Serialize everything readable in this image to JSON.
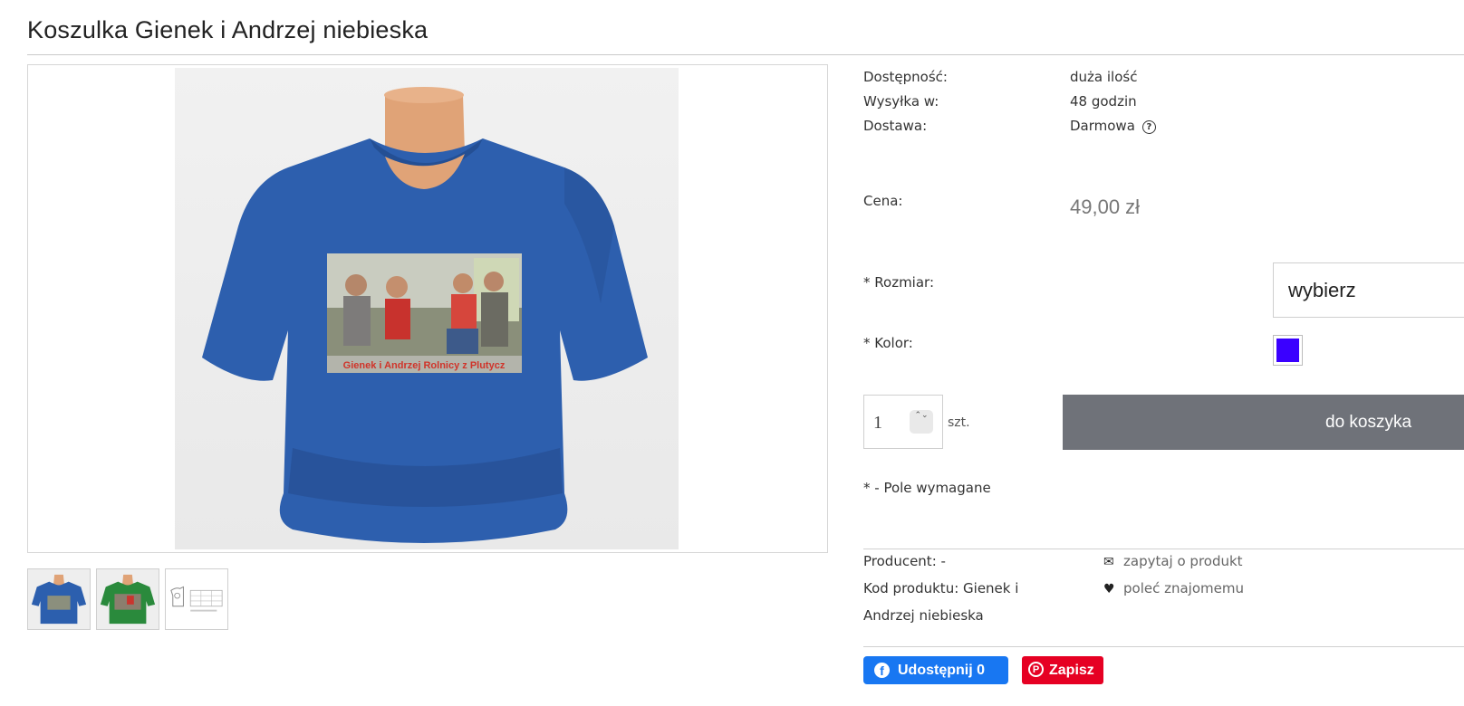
{
  "product": {
    "title": "Koszulka Gienek i Andrzej niebieska",
    "print_caption": "Gienek i Andrzej Rolnicy z Plutycz"
  },
  "gallery": {
    "thumbnails": [
      {
        "name": "thumb-blue-shirt",
        "shirt_color": "#2c5fae"
      },
      {
        "name": "thumb-green-shirt",
        "shirt_color": "#2a8a3c"
      },
      {
        "name": "thumb-size-chart",
        "shirt_color": "#ffffff"
      }
    ]
  },
  "availability": {
    "label": "Dostępność:",
    "value": "duża ilość"
  },
  "shipping": {
    "label": "Wysyłka w:",
    "value": "48 godzin"
  },
  "delivery": {
    "label": "Dostawa:",
    "value": "Darmowa",
    "help_icon": "?"
  },
  "price": {
    "label": "Cena:",
    "value": "49,00 zł"
  },
  "size": {
    "label": "* Rozmiar:",
    "selected": "wybierz"
  },
  "color": {
    "label": "* Kolor:",
    "swatch": "#3a00ff"
  },
  "quantity": {
    "value": "1",
    "unit": "szt.",
    "spinner": "⌃⌄"
  },
  "cart": {
    "button_label": "do koszyka"
  },
  "required_note": "* - Pole wymagane",
  "producer": {
    "label": "Producent:",
    "value": "-"
  },
  "product_code": {
    "label": "Kod produktu:",
    "line1": "Gienek i",
    "line2": "Andrzej niebieska"
  },
  "links": {
    "ask": {
      "icon": "envelope-icon",
      "label": "zapytaj o produkt"
    },
    "recommend": {
      "icon": "heart-icon",
      "label": "poleć znajomemu"
    }
  },
  "share": {
    "facebook": {
      "label": "Udostępnij 0",
      "icon": "f"
    },
    "pinterest": {
      "label": "Zapisz",
      "icon": "P"
    }
  },
  "colors": {
    "cart_button": "#6f7279",
    "facebook": "#1877f2",
    "pinterest": "#e60023",
    "price": "#777777"
  }
}
